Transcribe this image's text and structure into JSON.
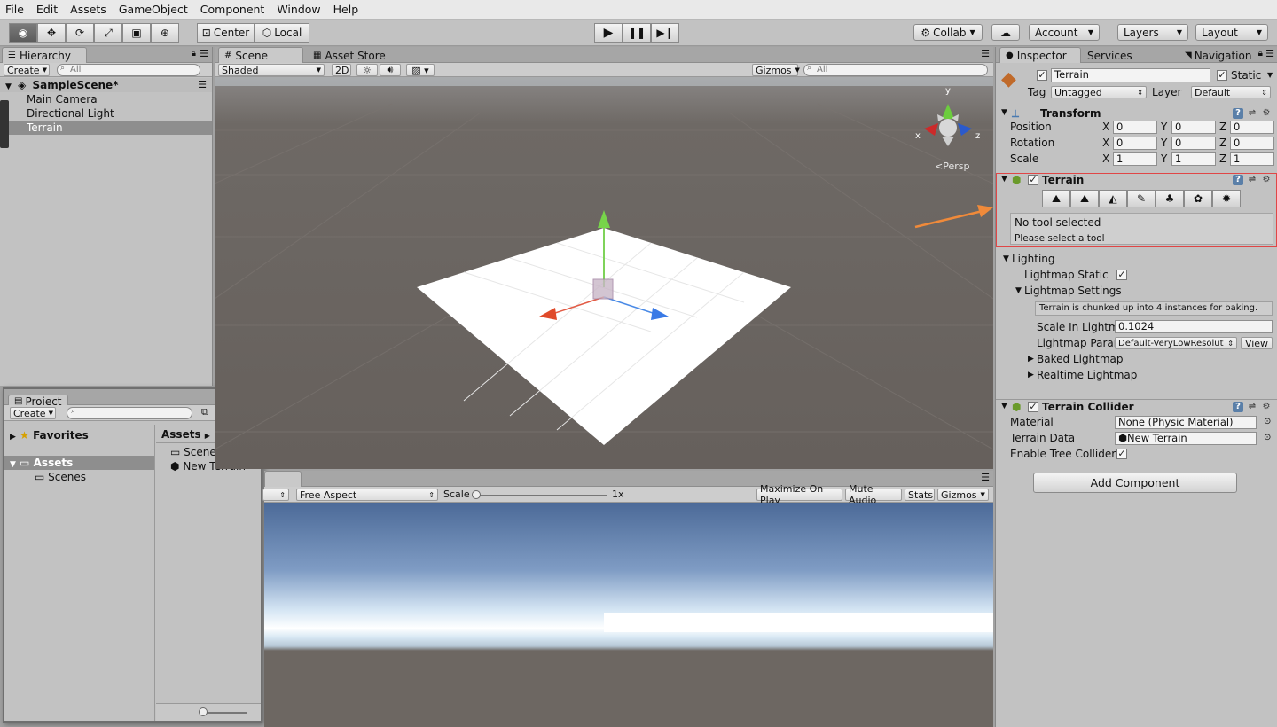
{
  "menu": [
    "File",
    "Edit",
    "Assets",
    "GameObject",
    "Component",
    "Window",
    "Help"
  ],
  "toolbar": {
    "center": "Center",
    "local": "Local",
    "collab": "Collab",
    "account": "Account",
    "layers": "Layers",
    "layout": "Layout"
  },
  "hierarchy": {
    "tab": "Hierarchy",
    "create": "Create",
    "search": "All",
    "scene": "SampleScene*",
    "items": [
      "Main Camera",
      "Directional Light",
      "Terrain"
    ]
  },
  "scene_view": {
    "tab_scene": "Scene",
    "tab_store": "Asset Store",
    "shaded": "Shaded",
    "mode2d": "2D",
    "gizmos": "Gizmos",
    "search": "All",
    "persp": "Persp",
    "axis_x": "x",
    "axis_y": "y",
    "axis_z": "z"
  },
  "game_view": {
    "aspect": "Free Aspect",
    "scale_label": "Scale",
    "scale_value": "1x",
    "maximize": "Maximize On Play",
    "mute": "Mute Audio",
    "stats": "Stats",
    "gizmos": "Gizmos"
  },
  "project": {
    "tab": "Project",
    "create": "Create",
    "favorites": "Favorites",
    "assets": "Assets",
    "scenes": "Scenes",
    "breadcrumb": "Assets",
    "items": [
      "Scenes",
      "New Terrain"
    ]
  },
  "inspector": {
    "tab_inspector": "Inspector",
    "tab_services": "Services",
    "tab_navigation": "Navigation",
    "object_name": "Terrain",
    "static": "Static",
    "tag_label": "Tag",
    "tag_value": "Untagged",
    "layer_label": "Layer",
    "layer_value": "Default",
    "transform": {
      "title": "Transform",
      "rows": [
        {
          "label": "Position",
          "x": "0",
          "y": "0",
          "z": "0"
        },
        {
          "label": "Rotation",
          "x": "0",
          "y": "0",
          "z": "0"
        },
        {
          "label": "Scale",
          "x": "1",
          "y": "1",
          "z": "1"
        }
      ]
    },
    "terrain": {
      "title": "Terrain",
      "no_tool": "No tool selected",
      "please": "Please select a tool"
    },
    "lighting": {
      "title": "Lighting",
      "lightmap_static": "Lightmap Static",
      "settings": "Lightmap Settings",
      "info": "Terrain is chunked up into 4 instances for baking.",
      "scale_label": "Scale In Lightm",
      "scale_value": "0.1024",
      "param_label": "Lightmap Parar",
      "param_value": "Default-VeryLowResolut",
      "view": "View",
      "baked": "Baked Lightmap",
      "realtime": "Realtime Lightmap"
    },
    "collider": {
      "title": "Terrain Collider",
      "material_label": "Material",
      "material_value": "None (Physic Material)",
      "data_label": "Terrain Data",
      "data_value": "New Terrain",
      "tree_label": "Enable Tree Collider"
    },
    "add_component": "Add Component"
  },
  "colors": {
    "highlight": "#e04646",
    "arrow": "#f08a3a",
    "sky_top": "#4f6f9e",
    "ground": "#6b6561"
  }
}
